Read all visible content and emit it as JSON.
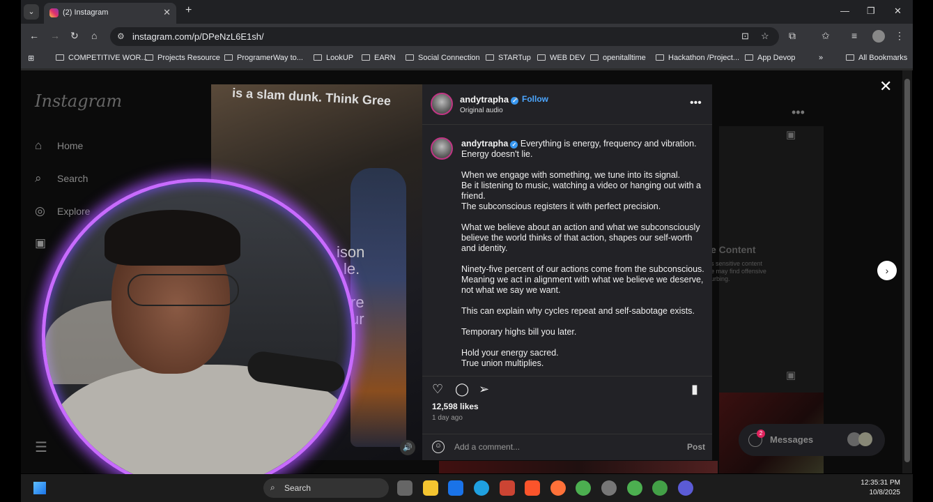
{
  "browser": {
    "tab_title": "(2) Instagram",
    "url": "instagram.com/p/DPeNzL6E1sh/",
    "bookmarks": [
      "COMPETITIVE WOR...",
      "Projects Resource",
      "ProgramerWay to...",
      "LookUP",
      "EARN",
      "Social Connection",
      "STARTup",
      "WEB DEV",
      "openitalltime",
      "Hackathon /Project...",
      "App Devop"
    ],
    "overflow": "»",
    "all_bookmarks": "All Bookmarks"
  },
  "sidebar": {
    "logo": "Instagram",
    "items": [
      {
        "label": "Home",
        "icon": "home-icon"
      },
      {
        "label": "Search",
        "icon": "search-icon"
      },
      {
        "label": "Explore",
        "icon": "compass-icon"
      }
    ]
  },
  "background": {
    "sensitive_title": "e Content",
    "sensitive_desc": "s sensitive content\ne may find offensive\nurbing."
  },
  "media": {
    "banner": "is a slam dunk. Think Gree",
    "frag1": "ison",
    "frag2": "le.",
    "frag3": "re",
    "frag4": "ur"
  },
  "post": {
    "username": "andytrapha",
    "dot": "•",
    "follow": "Follow",
    "audio": "Original audio",
    "caption_first": "Everything is energy, frequency and vibration.\nEnergy doesn't lie.",
    "caption_paragraphs": [
      "When we engage with something, we tune into its signal.\nBe it listening to music, watching a video or hanging out with a friend.\nThe subconscious registers it with perfect precision.",
      "What we believe about an action and what we subconsciously believe the world thinks of that action, shapes our self-worth and identity.",
      "Ninety-five percent of our actions come from the subconscious.\nMeaning we act in alignment with what we believe we deserve, not what we say we want.",
      "This can explain why cycles repeat and self-sabotage exists.",
      "Temporary highs bill you later.",
      "Hold your energy sacred.\nTrue union multiplies."
    ],
    "likes": "12,598 likes",
    "time": "1 day ago",
    "comment_placeholder": "Add a comment...",
    "post_button": "Post"
  },
  "messages": {
    "label": "Messages",
    "badge": "2"
  },
  "taskbar": {
    "search": "Search",
    "time": "12:35:31 PM",
    "date": "10/8/2025"
  },
  "colors": {
    "accent_blue": "#4ca6ff",
    "ring_purple": "#c86bff",
    "panel_bg": "#222226"
  }
}
